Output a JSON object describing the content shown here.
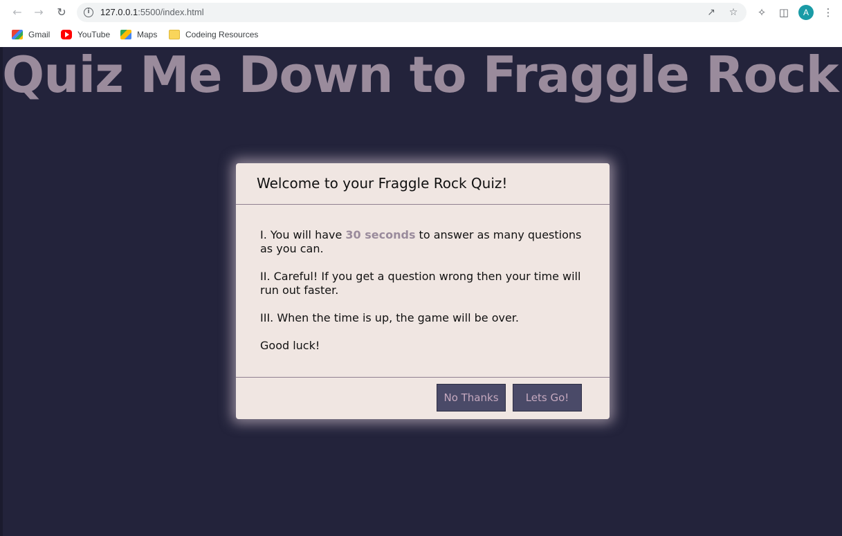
{
  "browser": {
    "url_host": "127.0.0.1",
    "url_path": ":5500/index.html",
    "avatar_initial": "A",
    "icons": [
      "back-icon",
      "forward-icon",
      "reload-icon",
      "info-icon",
      "share-icon",
      "star-icon",
      "extensions-icon",
      "sidepanel-icon",
      "menu-icon"
    ]
  },
  "bookmarks": [
    {
      "label": "Gmail",
      "icon": "gmail-icon"
    },
    {
      "label": "YouTube",
      "icon": "youtube-icon"
    },
    {
      "label": "Maps",
      "icon": "maps-icon"
    },
    {
      "label": "Codeing Resources",
      "icon": "folder-icon"
    }
  ],
  "page": {
    "heading": "Quiz Me Down to Fraggle Rock"
  },
  "modal": {
    "title": "Welcome to your Fraggle Rock Quiz!",
    "rule1_prefix": "I. You will have ",
    "rule1_highlight": "30 seconds",
    "rule1_suffix": " to answer as many questions as you can.",
    "rule2": "II. Careful! If you get a question wrong then your time will run out faster.",
    "rule3": "III. When the time is up, the game will be over.",
    "closing": "Good luck!",
    "no_button": "No Thanks",
    "go_button": "Lets Go!"
  },
  "colors": {
    "background": "#23233b",
    "heading": "#9a8b9c",
    "modal_bg": "#f0e6e2",
    "button_bg": "#4a4a68",
    "button_text": "#c6a9bf"
  }
}
